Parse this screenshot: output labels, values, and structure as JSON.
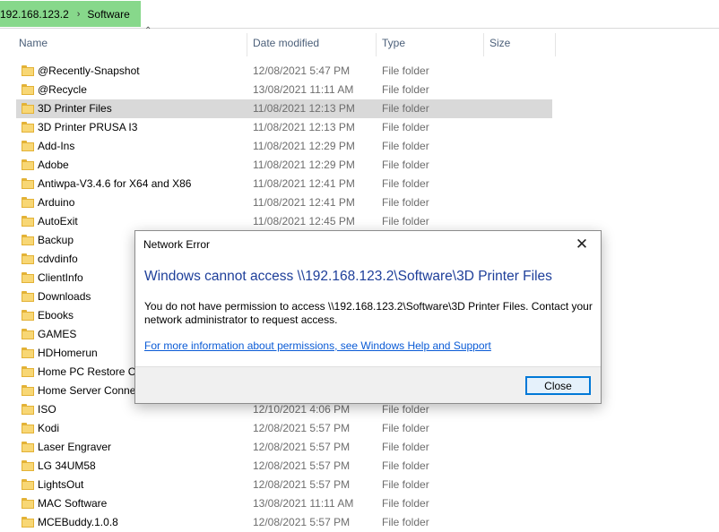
{
  "breadcrumb": {
    "host": "192.168.123.2",
    "folder": "Software"
  },
  "columns": {
    "name": "Name",
    "date": "Date modified",
    "type": "Type",
    "size": "Size"
  },
  "rows": [
    {
      "name": "@Recently-Snapshot",
      "date": "12/08/2021 5:47 PM",
      "type": "File folder"
    },
    {
      "name": "@Recycle",
      "date": "13/08/2021 11:11 AM",
      "type": "File folder"
    },
    {
      "name": "3D Printer Files",
      "date": "11/08/2021 12:13 PM",
      "type": "File folder",
      "selected": true
    },
    {
      "name": "3D Printer PRUSA I3",
      "date": "11/08/2021 12:13 PM",
      "type": "File folder"
    },
    {
      "name": "Add-Ins",
      "date": "11/08/2021 12:29 PM",
      "type": "File folder"
    },
    {
      "name": "Adobe",
      "date": "11/08/2021 12:29 PM",
      "type": "File folder"
    },
    {
      "name": "Antiwpa-V3.4.6 for X64 and X86",
      "date": "11/08/2021 12:41 PM",
      "type": "File folder"
    },
    {
      "name": "Arduino",
      "date": "11/08/2021 12:41 PM",
      "type": "File folder"
    },
    {
      "name": "AutoExit",
      "date": "11/08/2021 12:45 PM",
      "type": "File folder"
    },
    {
      "name": "Backup",
      "date": "",
      "type": ""
    },
    {
      "name": "cdvdinfo",
      "date": "",
      "type": ""
    },
    {
      "name": "ClientInfo",
      "date": "",
      "type": ""
    },
    {
      "name": "Downloads",
      "date": "",
      "type": ""
    },
    {
      "name": "Ebooks",
      "date": "",
      "type": ""
    },
    {
      "name": "GAMES",
      "date": "",
      "type": ""
    },
    {
      "name": "HDHomerun",
      "date": "",
      "type": ""
    },
    {
      "name": "Home PC Restore CD",
      "date": "",
      "type": ""
    },
    {
      "name": "Home Server Connector",
      "date": "",
      "type": ""
    },
    {
      "name": "ISO",
      "date": "12/10/2021 4:06 PM",
      "type": "File folder"
    },
    {
      "name": "Kodi",
      "date": "12/08/2021 5:57 PM",
      "type": "File folder"
    },
    {
      "name": "Laser Engraver",
      "date": "12/08/2021 5:57 PM",
      "type": "File folder"
    },
    {
      "name": "LG 34UM58",
      "date": "12/08/2021 5:57 PM",
      "type": "File folder"
    },
    {
      "name": "LightsOut",
      "date": "12/08/2021 5:57 PM",
      "type": "File folder"
    },
    {
      "name": "MAC Software",
      "date": "13/08/2021 11:11 AM",
      "type": "File folder"
    },
    {
      "name": "MCEBuddy.1.0.8",
      "date": "12/08/2021 5:57 PM",
      "type": "File folder"
    }
  ],
  "dialog": {
    "title": "Network Error",
    "heading": "Windows cannot access \\\\192.168.123.2\\Software\\3D Printer Files",
    "message": "You do not have permission to access \\\\192.168.123.2\\Software\\3D Printer Files. Contact your network administrator to request access.",
    "link": "For more information about permissions, see Windows Help and Support",
    "close_label": "Close",
    "close_icon": "✕"
  },
  "colors": {
    "breadcrumb_bg": "#87d88b",
    "selection": "#d9d9d9",
    "heading": "#1e3f9a",
    "link": "#0a5bd6",
    "button_border": "#0078d7"
  }
}
